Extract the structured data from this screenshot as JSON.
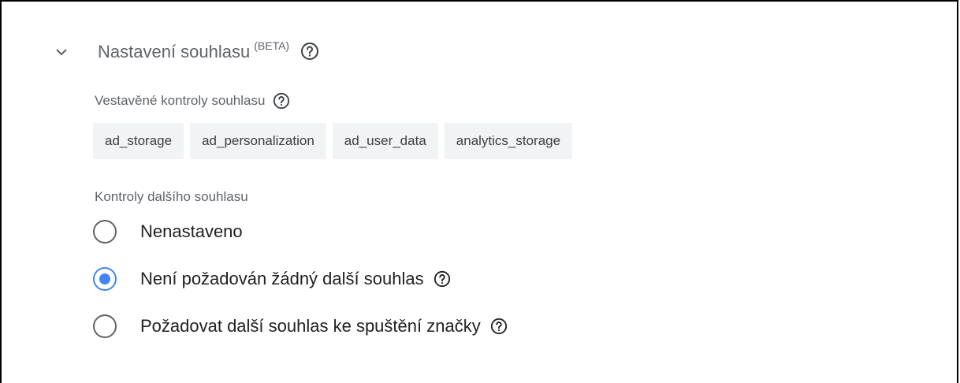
{
  "section": {
    "title": "Nastavení souhlasu",
    "beta": "(BETA)",
    "expand_icon": "chevron-down-icon",
    "help_icon": "help-circle-icon"
  },
  "builtin_checks": {
    "label": "Vestavěné kontroly souhlasu",
    "chips": [
      "ad_storage",
      "ad_personalization",
      "ad_user_data",
      "analytics_storage"
    ]
  },
  "additional_consent": {
    "label": "Kontroly dalšího souhlasu",
    "options": [
      {
        "label": "Nenastaveno",
        "selected": false
      },
      {
        "label": "Není požadován žádný další souhlas",
        "selected": true
      },
      {
        "label": "Požadovat další souhlas ke spuštění značky",
        "selected": false
      }
    ]
  },
  "colors": {
    "accent": "#4285f4",
    "muted_text": "#5f6368",
    "chip_bg": "#f1f3f4"
  }
}
